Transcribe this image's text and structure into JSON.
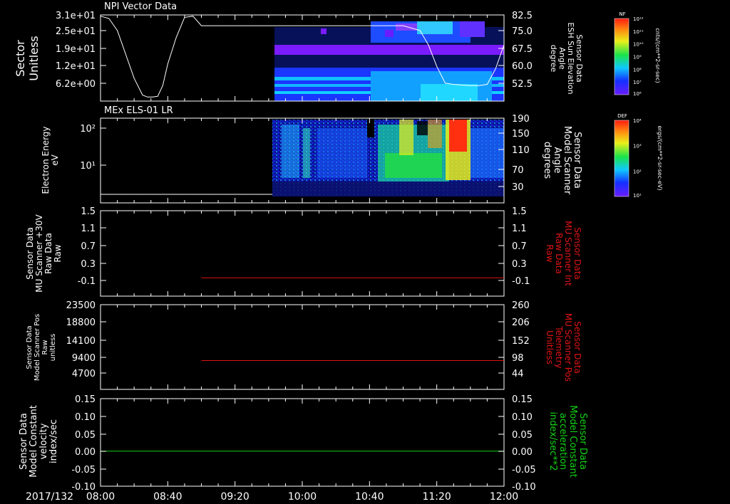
{
  "window": {
    "date_label": "2017/132"
  },
  "colors": {
    "bg": "#000000",
    "fg": "#ffffff",
    "red": "#e01414",
    "green": "#14d214"
  },
  "colorbars": [
    {
      "title": "NF",
      "max_label": "10¹²",
      "min_label": "10⁶",
      "ticks": [
        "10¹¹",
        "10¹⁰",
        "10⁹",
        "10⁸",
        "10⁷"
      ],
      "unit": "cnts/(cm**2-sr-sec)"
    },
    {
      "title": "DEF",
      "max_label": "10⁴",
      "min_label": "10¹",
      "ticks": [
        "10³",
        "10²"
      ],
      "unit": "ergs/(cm**2-sr-sec-eV)"
    }
  ],
  "chart_data": [
    {
      "type": "heatmap",
      "title": "NPI Vector Data",
      "ylabel": [
        "Sector",
        "Unitless"
      ],
      "yticks": [
        "3.1e+01",
        "2.5e+01",
        "1.9e+01",
        "1.2e+01",
        "6.2e+00"
      ],
      "y2label": [
        "Sensor Data",
        "ESH Sun Elevation",
        "Angle",
        "degree"
      ],
      "y2ticks": [
        "82.5",
        "75.0",
        "67.5",
        "60.0",
        "52.5"
      ],
      "y2lim": [
        46.5,
        82.5
      ],
      "overlay_line": {
        "name": "ESH Sun Elevation Angle",
        "t": [
          0,
          5,
          10,
          15,
          20,
          25,
          28,
          31,
          34,
          37,
          40,
          45,
          50,
          55,
          60,
          70,
          80,
          90,
          100,
          110,
          120,
          130,
          140,
          150,
          160,
          170,
          180,
          190,
          195,
          200,
          205,
          210,
          215,
          220,
          225,
          230,
          235,
          240
        ],
        "values": [
          82,
          81,
          76,
          66,
          56,
          49,
          48.2,
          48.2,
          48.5,
          53,
          62,
          73,
          81.5,
          82,
          78,
          78,
          78,
          78,
          78,
          78,
          78,
          78,
          78,
          78,
          78,
          78,
          78,
          76,
          70,
          61,
          54,
          53.5,
          53.2,
          53,
          53,
          53.5,
          60,
          70
        ]
      }
    },
    {
      "type": "heatmap",
      "title": "MEx ELS-01 LR",
      "ylabel": [
        "Electron Energy",
        "eV"
      ],
      "yticks": [
        "10²",
        "10¹"
      ],
      "y2label": [
        "Sensor Data",
        "Model Scanner",
        "Angle",
        "degrees"
      ],
      "y2ticks": [
        "190",
        "150",
        "110",
        "70",
        "30"
      ],
      "y2lim": [
        0,
        190
      ]
    },
    {
      "type": "line",
      "ylabel": [
        "Sensor Data",
        "MU Scanner +30V",
        "Raw Data",
        "Raw"
      ],
      "yticks": [
        "1.5",
        "1.1",
        "0.7",
        "0.3",
        "-0.1"
      ],
      "ylim": [
        -0.5,
        1.5
      ],
      "y2label": [
        "Sensor Data",
        "MU Scanner Int",
        "Raw Data",
        "Raw"
      ],
      "y2ticks": [
        "1.5",
        "1.1",
        "0.7",
        "0.3",
        "-0.1"
      ],
      "series": [
        {
          "name": "MU Scanner Int Raw Data",
          "t": [
            60,
            240
          ],
          "values": [
            -0.07,
            -0.07
          ]
        }
      ]
    },
    {
      "type": "line",
      "ylabel": [
        "Sensor Data",
        "Model Scanner Pos",
        "Raw",
        "unitless"
      ],
      "yticks": [
        "23500",
        "18800",
        "14100",
        "9400",
        "4700"
      ],
      "ylim": [
        0,
        23500
      ],
      "y2label": [
        "Sensor Data",
        "MU Scanner Pos",
        "Telemetry",
        "Unitless"
      ],
      "y2ticks": [
        "260",
        "206",
        "152",
        "98",
        "44"
      ],
      "series": [
        {
          "name": "MU Scanner Pos Telemetry",
          "t": [
            60,
            240
          ],
          "values": [
            8000,
            8000
          ]
        }
      ]
    },
    {
      "type": "line",
      "ylabel": [
        "Sensor Data",
        "Model Constant",
        "velocity",
        "index/sec"
      ],
      "yticks": [
        "0.15",
        "0.10",
        "0.05",
        "0.00",
        "-0.05",
        "-0.10"
      ],
      "ylim": [
        -0.1,
        0.15
      ],
      "y2label": [
        "Sensor Data",
        "Model Constant",
        "acceleration",
        "index/sec**2"
      ],
      "y2ticks": [
        "0.15",
        "0.10",
        "0.05",
        "0.00",
        "-0.05",
        "-0.10"
      ],
      "series": [
        {
          "name": "Model Constant acceleration",
          "t": [
            0,
            240
          ],
          "values": [
            0.0,
            0.0
          ]
        }
      ]
    }
  ],
  "x_axis": {
    "labels": [
      "08:00",
      "08:40",
      "09:20",
      "10:00",
      "10:40",
      "11:20",
      "12:00"
    ],
    "label_minutes": [
      0,
      40,
      80,
      120,
      160,
      200,
      240
    ]
  }
}
